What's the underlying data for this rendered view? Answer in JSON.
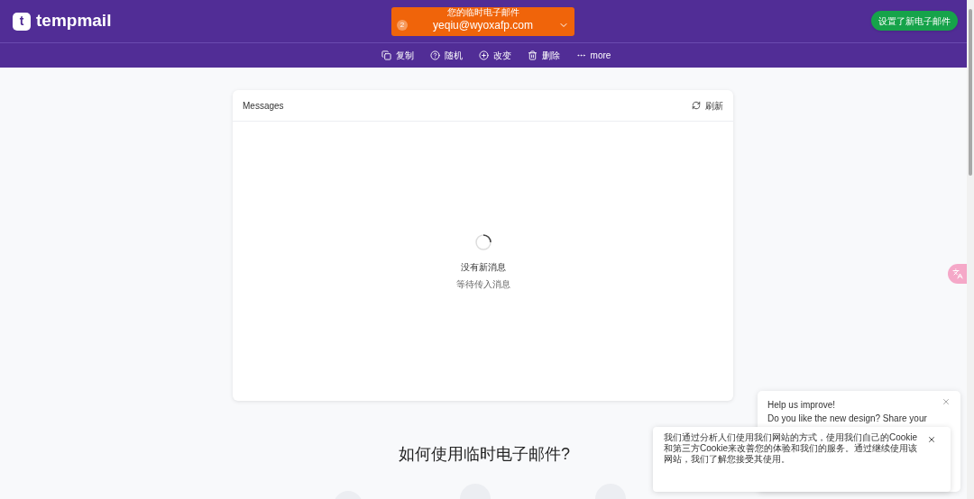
{
  "header": {
    "logo_letter": "t",
    "logo_text": "tempmail",
    "address_label": "您的临时电子邮件",
    "address_count": "2",
    "address": "yeqiu@wyoxafp.com",
    "toast": "设置了新电子邮件"
  },
  "toolbar": [
    {
      "kind": "copy",
      "label": "复制"
    },
    {
      "kind": "random",
      "label": "随机"
    },
    {
      "kind": "change",
      "label": "改变"
    },
    {
      "kind": "delete",
      "label": "删除"
    },
    {
      "kind": "more",
      "label": "more"
    }
  ],
  "messages": {
    "title": "Messages",
    "refresh": "刷新",
    "empty_title": "没有新消息",
    "empty_subtitle": "等待传入消息"
  },
  "how_to": {
    "title": "如何使用临时电子邮件?"
  },
  "feedback": {
    "title": "Help us improve!",
    "text": "Do you like the new design? Share your"
  },
  "cookie": {
    "text": "我们通过分析人们使用我们网站的方式，使用我们自己的Cookie和第三方Cookie来改善您的体验和我们的服务。通过继续使用该网站，我们了解您接受其使用。"
  }
}
